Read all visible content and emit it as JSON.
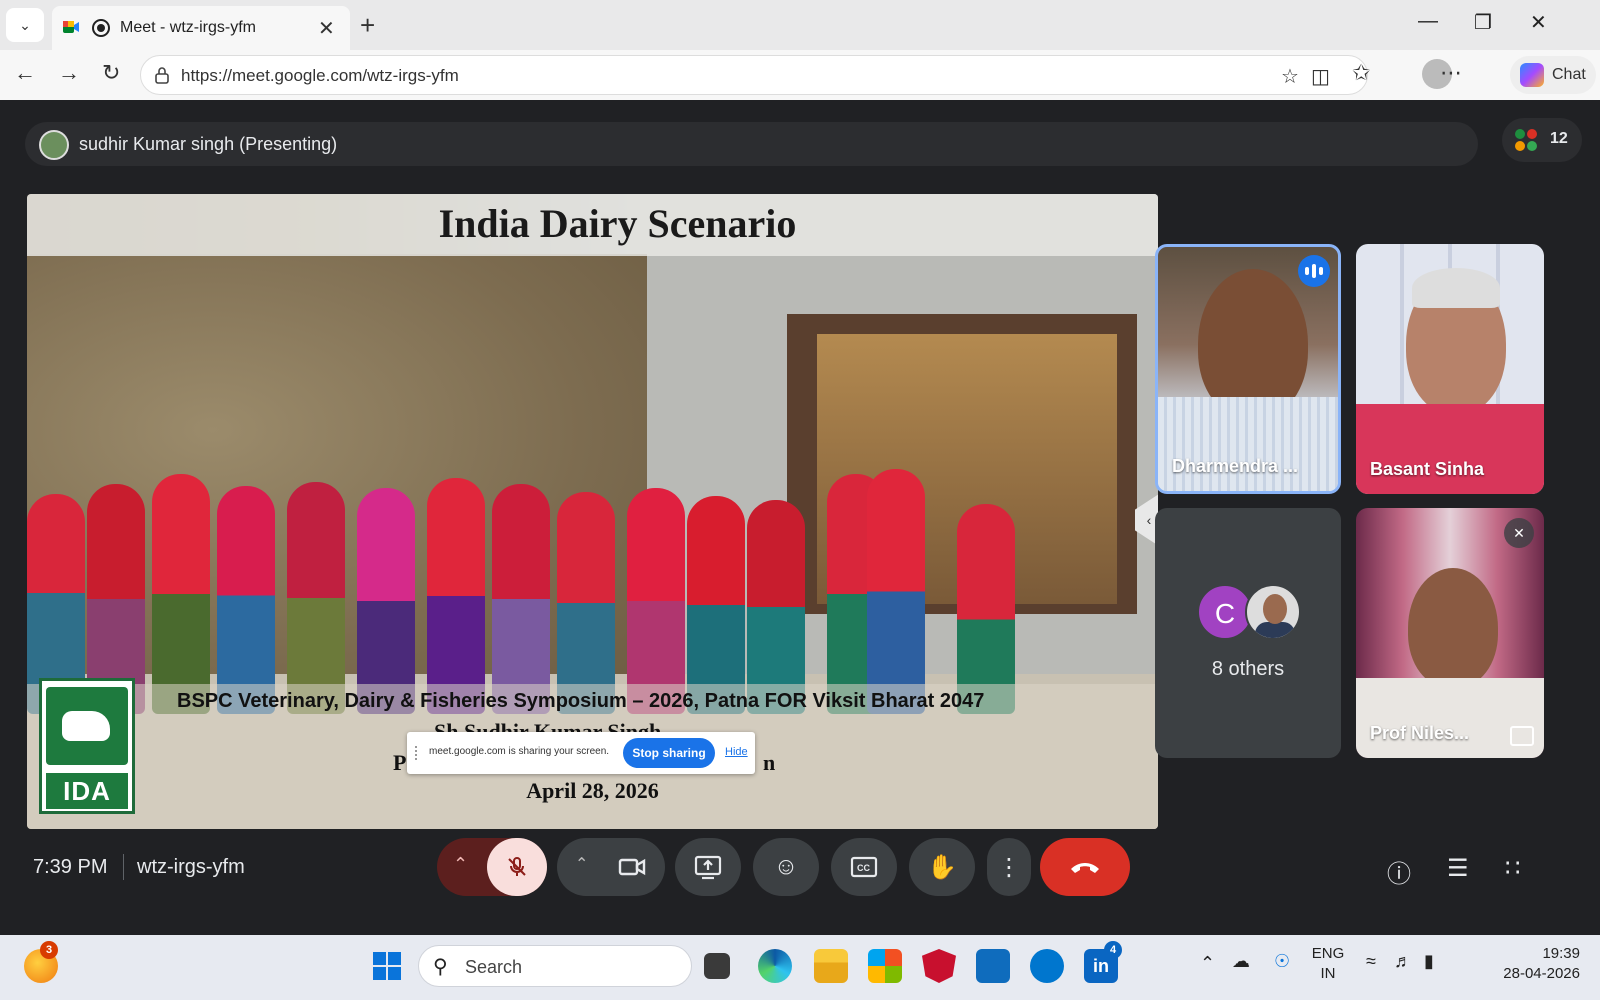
{
  "browser": {
    "tab_title": "Meet - wtz-irgs-yfm",
    "tab_close": "✕",
    "new_tab": "+",
    "url": "https://meet.google.com/wtz-irgs-yfm",
    "chat_label": "Chat"
  },
  "meet": {
    "presenter_label": "sudhir Kumar singh (Presenting)",
    "participant_count": "12",
    "slide": {
      "title": "India Dairy Scenario",
      "subtitle": "BSPC  Veterinary, Dairy & Fisheries Symposium – 2026, Patna FOR Viksit Bharat 2047",
      "speaker": "Sh Sudhir Kumar Singh",
      "designation_left": "P",
      "designation_right": "n",
      "date": "April 28, 2026",
      "logo_text": "IDA"
    },
    "share_banner": {
      "message": "meet.google.com is sharing your screen.",
      "stop_label": "Stop sharing",
      "hide_label": "Hide"
    },
    "tiles": [
      {
        "name": "Dharmendra ...",
        "speaking": true
      },
      {
        "name": "Basant Sinha"
      },
      {
        "avatar_letter": "C",
        "others_label": "8 others"
      },
      {
        "name": "Prof Niles...",
        "muted": true
      }
    ],
    "time": "7:39 PM",
    "meeting_code": "wtz-irgs-yfm",
    "colors": {
      "background": "#202124",
      "end_call": "#d93025",
      "mic_muted_bg": "#f9dedc",
      "accent": "#1a73e8"
    }
  },
  "taskbar": {
    "search_placeholder": "Search",
    "weather_badge": "3",
    "linkedin_badge": "4",
    "lang_top": "ENG",
    "lang_bottom": "IN",
    "time": "19:39",
    "date": "28-04-2026"
  }
}
